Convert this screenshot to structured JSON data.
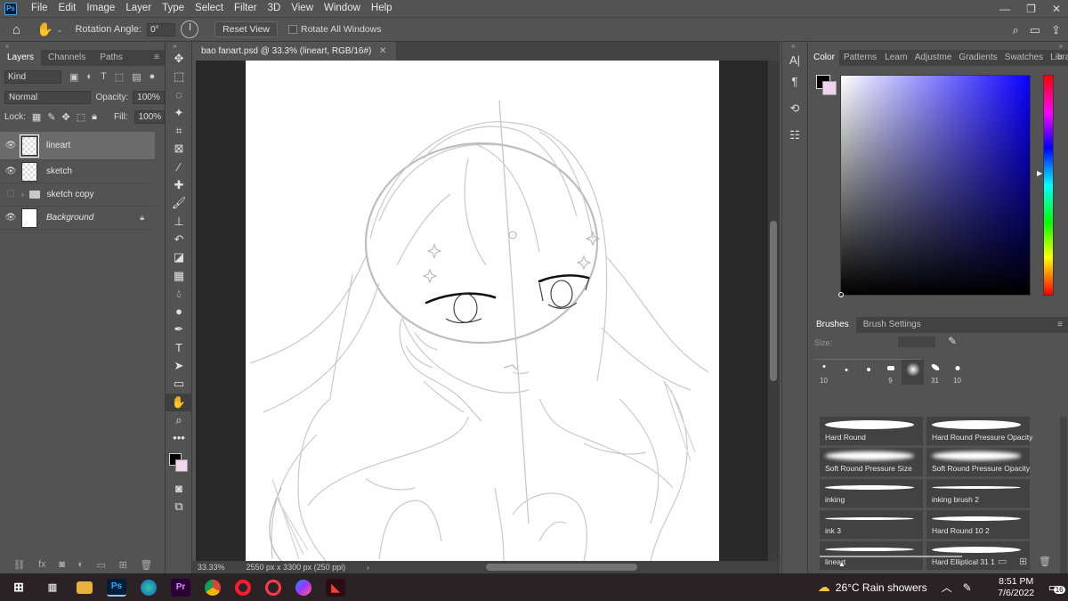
{
  "app": {
    "logo": "Ps"
  },
  "menu": [
    "File",
    "Edit",
    "Image",
    "Layer",
    "Type",
    "Select",
    "Filter",
    "3D",
    "View",
    "Window",
    "Help"
  ],
  "options_bar": {
    "rotation_label": "Rotation Angle:",
    "rotation_value": "0°",
    "reset_view": "Reset View",
    "rotate_all": "Rotate All Windows"
  },
  "layers_panel": {
    "tabs": [
      "Layers",
      "Channels",
      "Paths"
    ],
    "filter_kind": "Kind",
    "blend_mode": "Normal",
    "opacity_label": "Opacity:",
    "opacity_value": "100%",
    "lock_label": "Lock:",
    "fill_label": "Fill:",
    "fill_value": "100%",
    "layers": [
      {
        "name": "lineart",
        "visible": true,
        "selected": true
      },
      {
        "name": "sketch",
        "visible": true,
        "selected": false
      },
      {
        "name": "sketch copy",
        "visible": false,
        "type": "group"
      },
      {
        "name": "Background",
        "visible": true,
        "locked": true
      }
    ]
  },
  "document": {
    "tab_title": "bao fanart.psd @ 33.3% (lineart, RGB/16#)",
    "zoom": "33.33%",
    "doc_info": "2550 px x 3300 px (250 ppi)"
  },
  "color_panel": {
    "tabs": [
      "Color",
      "Patterns",
      "Learn",
      "Adjustme",
      "Gradients",
      "Swatches",
      "Libraries"
    ],
    "foreground": "#000000",
    "background": "#f0d3ee",
    "hue": "#0a00ff"
  },
  "brushes_panel": {
    "tabs": [
      "Brushes",
      "Brush Settings"
    ],
    "size_label": "Size:",
    "presets": [
      {
        "num": "10"
      },
      {
        "num": ""
      },
      {
        "num": ""
      },
      {
        "num": "9"
      },
      {
        "num": ""
      },
      {
        "num": "31"
      },
      {
        "num": "10"
      }
    ],
    "brushes": [
      "Hard Round",
      "Hard Round Pressure Opacity",
      "Soft Round Pressure Size",
      "Soft Round Pressure Opacity",
      "inking",
      "inking brush 2",
      "ink 3",
      "Hard Round 10 2",
      "lineart",
      "Hard Elliptical 31 1"
    ]
  },
  "taskbar": {
    "weather": "26°C  Rain showers",
    "time": "8:51 PM",
    "date": "7/6/2022",
    "notifications": "16"
  }
}
